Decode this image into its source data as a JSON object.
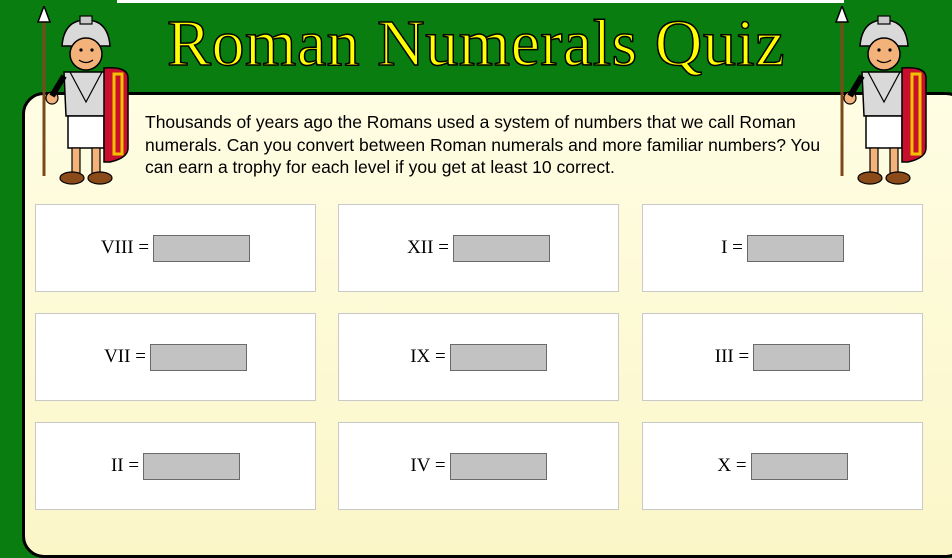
{
  "title": "Roman Numerals Quiz",
  "intro": "Thousands of years ago the Romans used a system of numbers that we call Roman numerals. Can you convert between Roman numerals and more familiar numbers? You can earn a trophy for each level if you get at least 10 correct.",
  "questions": [
    {
      "label": "VIII =",
      "value": ""
    },
    {
      "label": "XII =",
      "value": ""
    },
    {
      "label": "I =",
      "value": ""
    },
    {
      "label": "VII =",
      "value": ""
    },
    {
      "label": "IX =",
      "value": ""
    },
    {
      "label": "III =",
      "value": ""
    },
    {
      "label": "II =",
      "value": ""
    },
    {
      "label": "IV =",
      "value": ""
    },
    {
      "label": "X =",
      "value": ""
    }
  ],
  "icons": {
    "left": "roman-soldier-icon",
    "right": "roman-soldier-icon"
  },
  "colors": {
    "background": "#0a7d10",
    "title": "#ffff00",
    "panel": "#fffde3",
    "input": "#c2c2c2"
  }
}
